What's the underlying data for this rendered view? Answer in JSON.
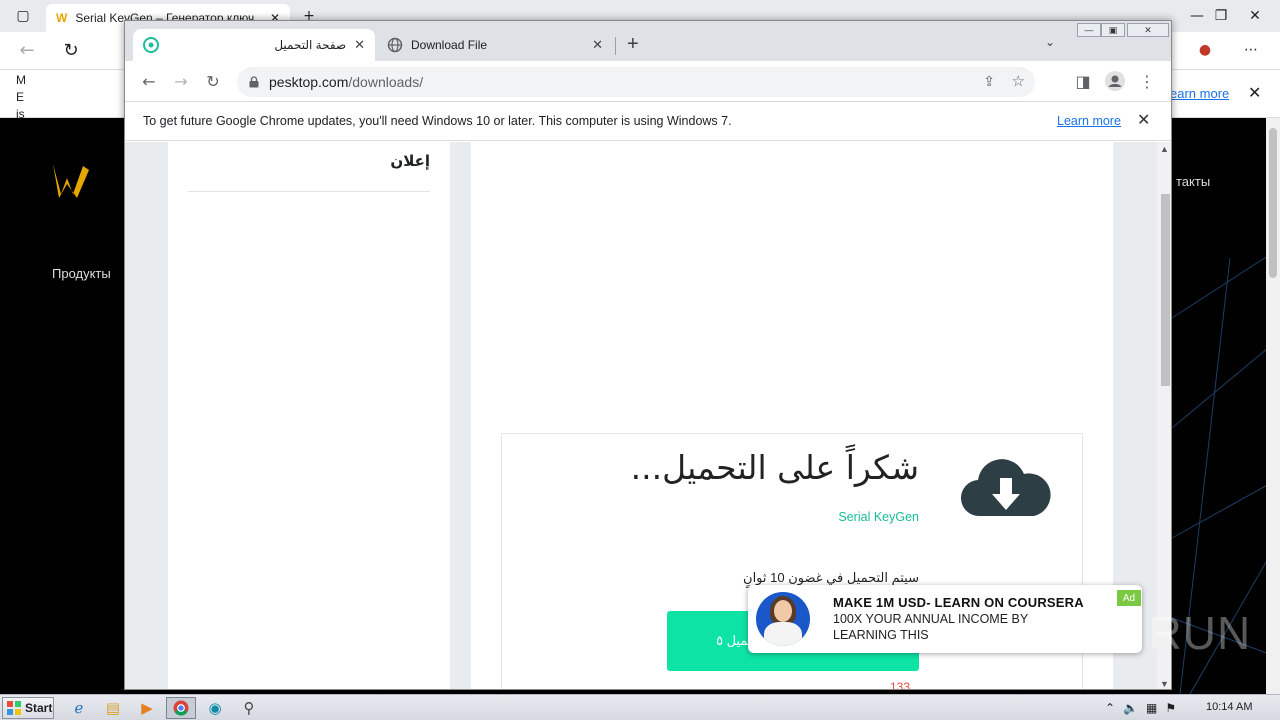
{
  "background_browser": {
    "tab_title": "Serial KeyGen – Генератор ключ",
    "info_learn_more": "earn more",
    "left_text_lines": [
      "M",
      "E",
      "is"
    ],
    "nav_products": "Продукты",
    "nav_contacts": "такты"
  },
  "chrome": {
    "tabs": [
      {
        "title": "صفحة التحميل",
        "active": true
      },
      {
        "title": "Download File",
        "active": false
      }
    ],
    "new_tab_symbol": "+",
    "url_host": "pesktop.com",
    "url_path": "/downloads/",
    "infobar": {
      "message": "To get future Google Chrome updates, you'll need Windows 10 or later. This computer is using Windows 7.",
      "learn_more": "Learn more"
    }
  },
  "page": {
    "sidebar_heading": "إعلان",
    "thanks_headline": "شكراً على التحميل...",
    "app_name": "Serial KeyGen",
    "countdown_text": "سيتم التحميل في غضون 10 ثوانٍ",
    "download_button": "تحميل ٥",
    "bottom_text_prefix": "...",
    "bottom_text_number": "133"
  },
  "ad": {
    "title": "MAKE 1M USD- LEARN ON COURSERA",
    "subtitle": "100X YOUR ANNUAL INCOME BY LEARNING THIS",
    "badge": "Ad"
  },
  "watermark": "ANY RUN",
  "taskbar": {
    "start_label": "Start",
    "clock": "10:14 AM"
  },
  "colors": {
    "accent_green": "#0ee3a6",
    "link_teal": "#1abc9c",
    "chrome_link": "#1a73e8"
  }
}
